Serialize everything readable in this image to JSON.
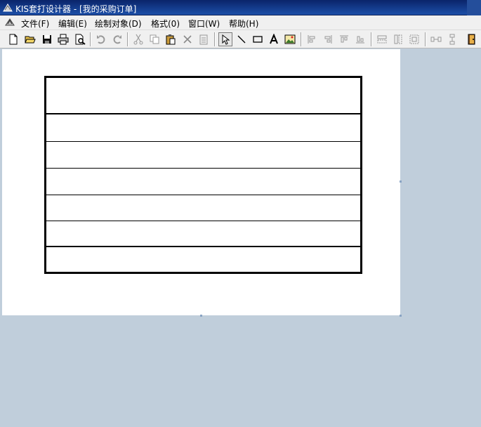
{
  "window": {
    "title": "KIS套打设计器 - [我的采购订单]"
  },
  "menu": {
    "items": [
      {
        "label": "文件(F)"
      },
      {
        "label": "编辑(E)"
      },
      {
        "label": "绘制对象(D)"
      },
      {
        "label": "格式(0)"
      },
      {
        "label": "窗口(W)"
      },
      {
        "label": "帮助(H)"
      }
    ]
  },
  "toolbar": {
    "buttons": [
      {
        "icon": "new-file-icon"
      },
      {
        "icon": "open-folder-icon"
      },
      {
        "icon": "save-icon"
      },
      {
        "icon": "print-icon"
      },
      {
        "icon": "print-preview-icon"
      },
      {
        "icon": "undo-icon"
      },
      {
        "icon": "redo-icon"
      },
      {
        "icon": "cut-icon"
      },
      {
        "icon": "copy-icon"
      },
      {
        "icon": "paste-icon"
      },
      {
        "icon": "delete-icon"
      },
      {
        "icon": "properties-icon"
      },
      {
        "icon": "select-pointer-icon"
      },
      {
        "icon": "draw-line-icon"
      },
      {
        "icon": "draw-rectangle-icon"
      },
      {
        "icon": "text-tool-icon"
      },
      {
        "icon": "image-tool-icon"
      },
      {
        "icon": "align-left-icon"
      },
      {
        "icon": "align-right-icon"
      },
      {
        "icon": "align-top-icon"
      },
      {
        "icon": "align-bottom-icon"
      },
      {
        "icon": "same-width-icon"
      },
      {
        "icon": "same-height-icon"
      },
      {
        "icon": "same-size-icon"
      },
      {
        "icon": "distribute-horizontal-icon"
      },
      {
        "icon": "distribute-vertical-icon"
      },
      {
        "icon": "exit-icon"
      }
    ]
  },
  "design": {
    "table_rows": 7
  }
}
